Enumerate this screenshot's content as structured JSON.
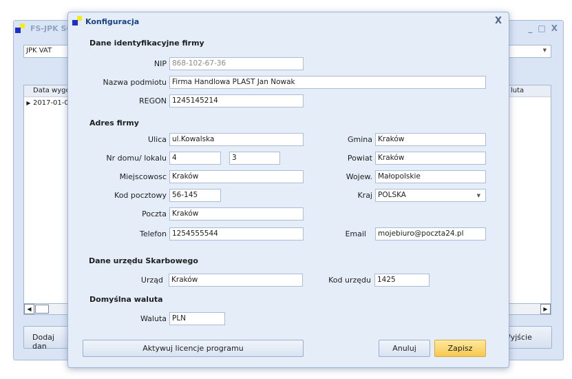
{
  "background_window": {
    "title": "FS-JPK SQ",
    "controls": {
      "minimize": "_",
      "maximize": "□",
      "close": "X"
    },
    "combo_value": "JPK VAT",
    "grid": {
      "headers": [
        "Data wyge",
        "luta"
      ],
      "first_row": "2017-01-0"
    },
    "buttons": {
      "add": "Dodaj dan",
      "exit": "Wyjście"
    }
  },
  "dialog": {
    "title": "Konfiguracja",
    "close_label": "X",
    "sections": {
      "company": "Dane identyfikacyjne firmy",
      "address": "Adres firmy",
      "tax_office": "Dane urzędu Skarbowego",
      "currency": "Domyślna waluta"
    },
    "company": {
      "nip_label": "NIP",
      "nip_value": "868-102-67-36",
      "name_label": "Nazwa podmiotu",
      "name_value": "Firma Handlowa PLAST Jan Nowak",
      "regon_label": "REGON",
      "regon_value": "1245145214"
    },
    "address": {
      "street_label": "Ulica",
      "street_value": "ul.Kowalska",
      "house_label": "Nr domu/ lokalu",
      "house_value": "4",
      "flat_value": "3",
      "city_label": "Miejscowosc",
      "city_value": "Kraków",
      "postcode_label": "Kod pocztowy",
      "postcode_value": "56-145",
      "post_label": "Poczta",
      "post_value": "Kraków",
      "phone_label": "Telefon",
      "phone_value": "1254555544",
      "commune_label": "Gmina",
      "commune_value": "Kraków",
      "district_label": "Powiat",
      "district_value": "Kraków",
      "province_label": "Wojew.",
      "province_value": "Małopolskie",
      "country_label": "Kraj",
      "country_value": "POLSKA",
      "email_label": "Email",
      "email_value": "mojebiuro@poczta24.pl"
    },
    "tax_office": {
      "office_label": "Urząd",
      "office_value": "Kraków",
      "code_label": "Kod urzędu",
      "code_value": "1425"
    },
    "currency": {
      "label": "Waluta",
      "value": "PLN"
    },
    "buttons": {
      "activate": "Aktywuj licencje programu",
      "cancel": "Anuluj",
      "save": "Zapisz"
    }
  }
}
